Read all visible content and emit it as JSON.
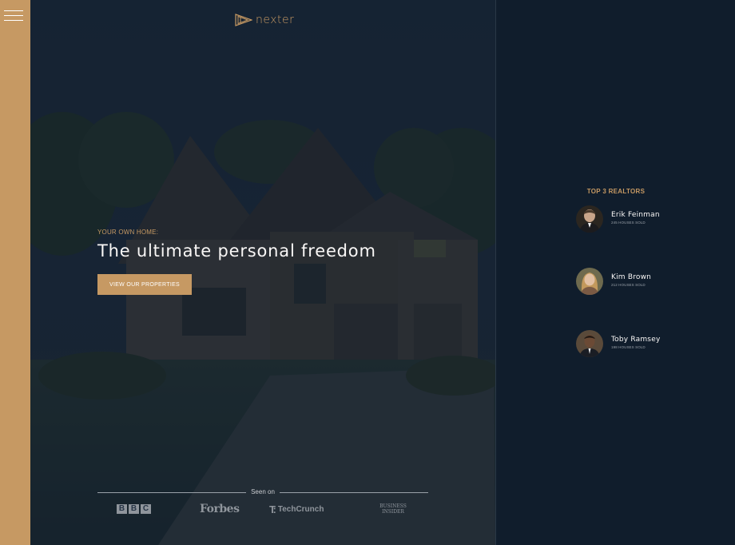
{
  "sidebar": {
    "menu_icon": "hamburger-menu-icon"
  },
  "header": {
    "logo_icon": "play-triangle-logo-icon",
    "logo_text": "nexter"
  },
  "hero": {
    "eyebrow": "YOUR OWN HOME:",
    "headline": "The ultimate personal freedom",
    "cta_label": "VIEW OUR PROPERTIES"
  },
  "seen_on": {
    "label": "Seen on",
    "brands": [
      {
        "name": "BBC",
        "icon": "bbc-logo"
      },
      {
        "name": "Forbes",
        "icon": "forbes-logo"
      },
      {
        "name": "TechCrunch",
        "icon": "techcrunch-logo"
      },
      {
        "name": "BUSINESS INSIDER",
        "icon": "business-insider-logo"
      }
    ]
  },
  "realtors": {
    "title": "TOP 3 REALTORS",
    "items": [
      {
        "name": "Erik Feinman",
        "sold": "245 HOUSES SOLD"
      },
      {
        "name": "Kim Brown",
        "sold": "212 HOUSES SOLD"
      },
      {
        "name": "Toby Ramsey",
        "sold": "198 HOUSES SOLD"
      }
    ]
  },
  "colors": {
    "primary": "#c69963",
    "dark": "#101d2c",
    "light": "#f9f7f6"
  }
}
